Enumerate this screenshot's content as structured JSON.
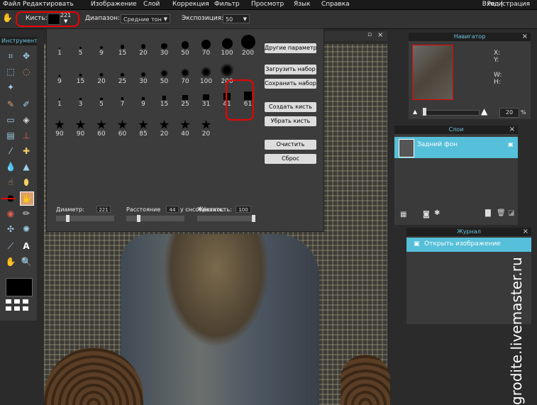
{
  "menubar": {
    "items": [
      "Файл",
      "Редактировать",
      "Изображение",
      "Слой",
      "Коррекция",
      "Фильтр",
      "Просмотр",
      "Язык",
      "Справка"
    ],
    "login": "Вход",
    "separator": "|",
    "register": "Регистрация"
  },
  "options": {
    "brush_label": "Кисть:",
    "brush_size": "221",
    "range_label": "Диапазон:",
    "range_value": "Средние тон",
    "exposure_label": "Экспозиция:",
    "exposure_value": "50"
  },
  "tools": {
    "title": "Инструмент"
  },
  "brush_popup": {
    "rows": [
      [
        "1",
        "5",
        "9",
        "15",
        "20",
        "30",
        "50",
        "70",
        "100",
        "200"
      ],
      [
        "9",
        "15",
        "20",
        "25",
        "30",
        "50",
        "70",
        "100",
        "200"
      ],
      [
        "1",
        "3",
        "5",
        "7",
        "9",
        "15",
        "25",
        "31",
        "41",
        "61"
      ],
      [
        "90",
        "90",
        "60",
        "60",
        "85",
        "20",
        "40",
        "20"
      ]
    ],
    "buttons": [
      "Другие параметры",
      "Загрузить набор",
      "Сохранить набор",
      "Создать кисть",
      "Убрать кисть",
      "Очистить",
      "Сброс"
    ],
    "sliders": {
      "diameter_label": "Диаметр:",
      "diameter_value": "221",
      "spacing_label": "Расстояние",
      "spacing_value": "44",
      "spacing_suffix": "у снсобравать:",
      "hardness_label": "Жёсткость:",
      "hardness_value": "100"
    }
  },
  "navigator": {
    "title": "Навигатор",
    "x_label": "X:",
    "y_label": "Y:",
    "w_label": "W:",
    "h_label": "H:",
    "zoom_value": "20",
    "zoom_unit": "%"
  },
  "layers": {
    "title": "Слои",
    "items": [
      {
        "name": "Задний фон"
      }
    ]
  },
  "history": {
    "title": "Журнал",
    "items": [
      {
        "name": "Открыть изображение"
      }
    ]
  },
  "watermark": "grodite.livemaster.ru",
  "colors": {
    "accent": "#56bfd9",
    "highlight": "#e00000"
  }
}
